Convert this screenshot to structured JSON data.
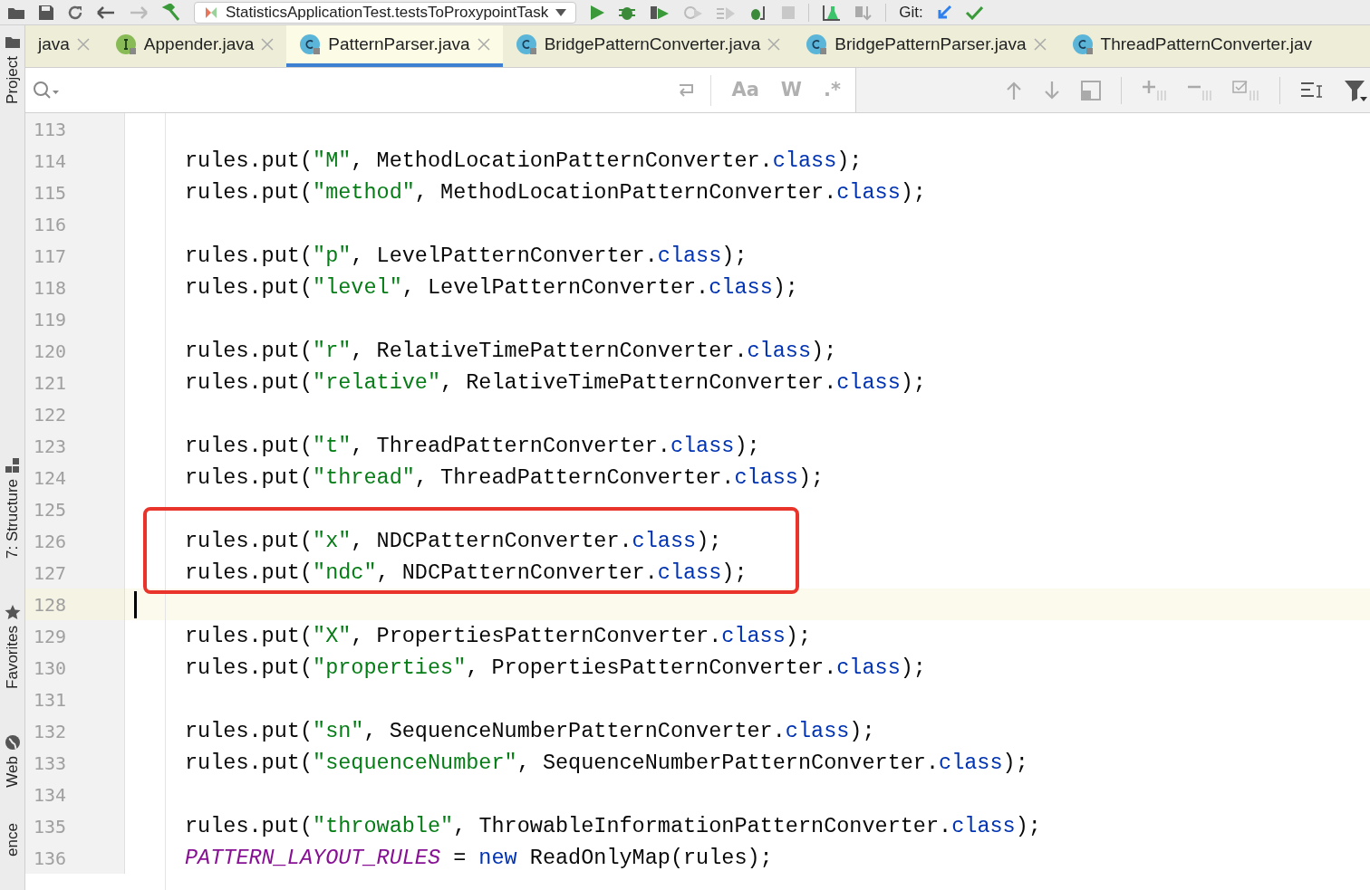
{
  "toolbar": {
    "run_config": "StatisticsApplicationTest.testsToProxypointTask",
    "vcs_label": "Git:"
  },
  "tool_strip": [
    {
      "label": "Project",
      "kind": "project"
    },
    {
      "label": "7: Structure",
      "kind": "structure"
    },
    {
      "label": "Favorites",
      "kind": "favorites"
    },
    {
      "label": "Web",
      "kind": "web"
    },
    {
      "label": "ence",
      "kind": "plain"
    }
  ],
  "tabs": [
    {
      "label": "java",
      "kind": "plain",
      "selected": false,
      "closable": true
    },
    {
      "label": "Appender.java",
      "kind": "interface",
      "selected": false,
      "closable": true
    },
    {
      "label": "PatternParser.java",
      "kind": "class",
      "selected": true,
      "closable": true
    },
    {
      "label": "BridgePatternConverter.java",
      "kind": "class",
      "selected": false,
      "closable": true
    },
    {
      "label": "BridgePatternParser.java",
      "kind": "class",
      "selected": false,
      "closable": true
    },
    {
      "label": "ThreadPatternConverter.jav",
      "kind": "class",
      "selected": false,
      "closable": false
    }
  ],
  "find_bar": {
    "toggles": [
      "Aa",
      "W",
      ".*"
    ]
  },
  "lines": [
    {
      "number": "113"
    },
    {
      "number": "114",
      "tokens": [
        {
          "kind": "plain",
          "text": "rules.put("
        },
        {
          "kind": "string",
          "text": "\"M\""
        },
        {
          "kind": "plain",
          "text": ", MethodLocationPatternConverter."
        },
        {
          "kind": "keyword",
          "text": "class"
        },
        {
          "kind": "plain",
          "text": ");"
        }
      ]
    },
    {
      "number": "115",
      "tokens": [
        {
          "kind": "plain",
          "text": "rules.put("
        },
        {
          "kind": "string",
          "text": "\"method\""
        },
        {
          "kind": "plain",
          "text": ", MethodLocationPatternConverter."
        },
        {
          "kind": "keyword",
          "text": "class"
        },
        {
          "kind": "plain",
          "text": ");"
        }
      ]
    },
    {
      "number": "116"
    },
    {
      "number": "117",
      "tokens": [
        {
          "kind": "plain",
          "text": "rules.put("
        },
        {
          "kind": "string",
          "text": "\"p\""
        },
        {
          "kind": "plain",
          "text": ", LevelPatternConverter."
        },
        {
          "kind": "keyword",
          "text": "class"
        },
        {
          "kind": "plain",
          "text": ");"
        }
      ]
    },
    {
      "number": "118",
      "tokens": [
        {
          "kind": "plain",
          "text": "rules.put("
        },
        {
          "kind": "string",
          "text": "\"level\""
        },
        {
          "kind": "plain",
          "text": ", LevelPatternConverter."
        },
        {
          "kind": "keyword",
          "text": "class"
        },
        {
          "kind": "plain",
          "text": ");"
        }
      ]
    },
    {
      "number": "119"
    },
    {
      "number": "120",
      "tokens": [
        {
          "kind": "plain",
          "text": "rules.put("
        },
        {
          "kind": "string",
          "text": "\"r\""
        },
        {
          "kind": "plain",
          "text": ", RelativeTimePatternConverter."
        },
        {
          "kind": "keyword",
          "text": "class"
        },
        {
          "kind": "plain",
          "text": ");"
        }
      ]
    },
    {
      "number": "121",
      "tokens": [
        {
          "kind": "plain",
          "text": "rules.put("
        },
        {
          "kind": "string",
          "text": "\"relative\""
        },
        {
          "kind": "plain",
          "text": ", RelativeTimePatternConverter."
        },
        {
          "kind": "keyword",
          "text": "class"
        },
        {
          "kind": "plain",
          "text": ");"
        }
      ]
    },
    {
      "number": "122"
    },
    {
      "number": "123",
      "tokens": [
        {
          "kind": "plain",
          "text": "rules.put("
        },
        {
          "kind": "string",
          "text": "\"t\""
        },
        {
          "kind": "plain",
          "text": ", ThreadPatternConverter."
        },
        {
          "kind": "keyword",
          "text": "class"
        },
        {
          "kind": "plain",
          "text": ");"
        }
      ]
    },
    {
      "number": "124",
      "tokens": [
        {
          "kind": "plain",
          "text": "rules.put("
        },
        {
          "kind": "string",
          "text": "\"thread\""
        },
        {
          "kind": "plain",
          "text": ", ThreadPatternConverter."
        },
        {
          "kind": "keyword",
          "text": "class"
        },
        {
          "kind": "plain",
          "text": ");"
        }
      ]
    },
    {
      "number": "125"
    },
    {
      "number": "126",
      "tokens": [
        {
          "kind": "plain",
          "text": "rules.put("
        },
        {
          "kind": "string",
          "text": "\"x\""
        },
        {
          "kind": "plain",
          "text": ", NDCPatternConverter."
        },
        {
          "kind": "keyword",
          "text": "class"
        },
        {
          "kind": "plain",
          "text": ");"
        }
      ],
      "boxed": true
    },
    {
      "number": "127",
      "tokens": [
        {
          "kind": "plain",
          "text": "rules.put("
        },
        {
          "kind": "string",
          "text": "\"ndc\""
        },
        {
          "kind": "plain",
          "text": ", NDCPatternConverter."
        },
        {
          "kind": "keyword",
          "text": "class"
        },
        {
          "kind": "plain",
          "text": ");"
        }
      ],
      "boxed": true
    },
    {
      "number": "128",
      "current": true
    },
    {
      "number": "129",
      "tokens": [
        {
          "kind": "plain",
          "text": "rules.put("
        },
        {
          "kind": "string",
          "text": "\"X\""
        },
        {
          "kind": "plain",
          "text": ", PropertiesPatternConverter."
        },
        {
          "kind": "keyword",
          "text": "class"
        },
        {
          "kind": "plain",
          "text": ");"
        }
      ]
    },
    {
      "number": "130",
      "tokens": [
        {
          "kind": "plain",
          "text": "rules.put("
        },
        {
          "kind": "string",
          "text": "\"properties\""
        },
        {
          "kind": "plain",
          "text": ", PropertiesPatternConverter."
        },
        {
          "kind": "keyword",
          "text": "class"
        },
        {
          "kind": "plain",
          "text": ");"
        }
      ]
    },
    {
      "number": "131"
    },
    {
      "number": "132",
      "tokens": [
        {
          "kind": "plain",
          "text": "rules.put("
        },
        {
          "kind": "string",
          "text": "\"sn\""
        },
        {
          "kind": "plain",
          "text": ", SequenceNumberPatternConverter."
        },
        {
          "kind": "keyword",
          "text": "class"
        },
        {
          "kind": "plain",
          "text": ");"
        }
      ]
    },
    {
      "number": "133",
      "tokens": [
        {
          "kind": "plain",
          "text": "rules.put("
        },
        {
          "kind": "string",
          "text": "\"sequenceNumber\""
        },
        {
          "kind": "plain",
          "text": ", SequenceNumberPatternConverter."
        },
        {
          "kind": "keyword",
          "text": "class"
        },
        {
          "kind": "plain",
          "text": ");"
        }
      ]
    },
    {
      "number": "134"
    },
    {
      "number": "135",
      "tokens": [
        {
          "kind": "plain",
          "text": "rules.put("
        },
        {
          "kind": "string",
          "text": "\"throwable\""
        },
        {
          "kind": "plain",
          "text": ", ThrowableInformationPatternConverter."
        },
        {
          "kind": "keyword",
          "text": "class"
        },
        {
          "kind": "plain",
          "text": ");"
        }
      ]
    },
    {
      "number": "136",
      "tokens": [
        {
          "kind": "static",
          "text": "PATTERN_LAYOUT_RULES"
        },
        {
          "kind": "plain",
          "text": " = "
        },
        {
          "kind": "keyword",
          "text": "new"
        },
        {
          "kind": "plain",
          "text": " ReadOnlyMap(rules);"
        }
      ]
    }
  ]
}
